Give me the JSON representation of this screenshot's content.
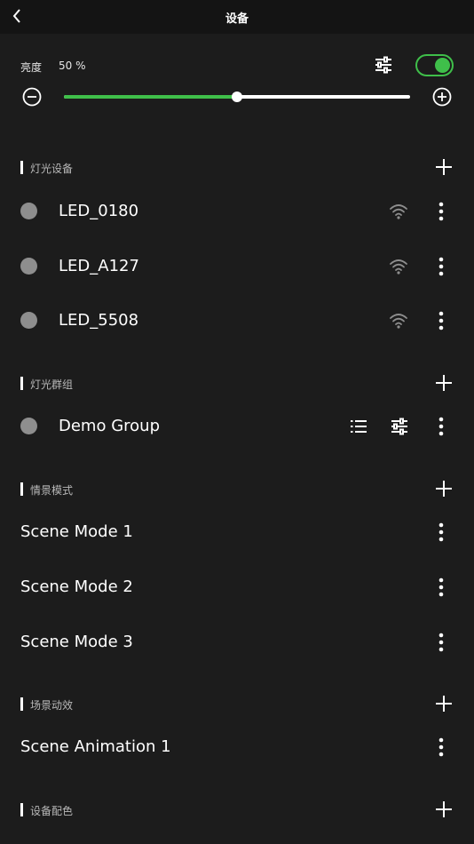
{
  "header": {
    "title": "设备"
  },
  "brightness": {
    "label": "亮度",
    "value_text": "50 %",
    "level_percent": 50,
    "enabled": true
  },
  "colors": {
    "accent": "#3fbf4a",
    "background": "#1c1c1c",
    "topbar": "#141414",
    "status_dot": "#8e8e8e"
  },
  "sections": {
    "lights": {
      "title": "灯光设备",
      "items": [
        {
          "label": "LED_0180"
        },
        {
          "label": "LED_A127"
        },
        {
          "label": "LED_5508"
        }
      ]
    },
    "groups": {
      "title": "灯光群组",
      "items": [
        {
          "label": "Demo Group"
        }
      ]
    },
    "scenes": {
      "title": "情景模式",
      "items": [
        {
          "label": "Scene Mode 1"
        },
        {
          "label": "Scene Mode 2"
        },
        {
          "label": "Scene Mode 3"
        }
      ]
    },
    "animations": {
      "title": "场景动效",
      "items": [
        {
          "label": "Scene Animation 1"
        }
      ]
    },
    "palettes": {
      "title": "设备配色"
    }
  },
  "icons": {
    "back": "chevron-left-icon",
    "adjust": "sliders-icon",
    "minus": "minus-circle-icon",
    "plus": "plus-circle-icon",
    "add": "plus-icon",
    "wifi": "wifi-icon",
    "more": "more-vertical-icon",
    "list": "list-icon"
  }
}
